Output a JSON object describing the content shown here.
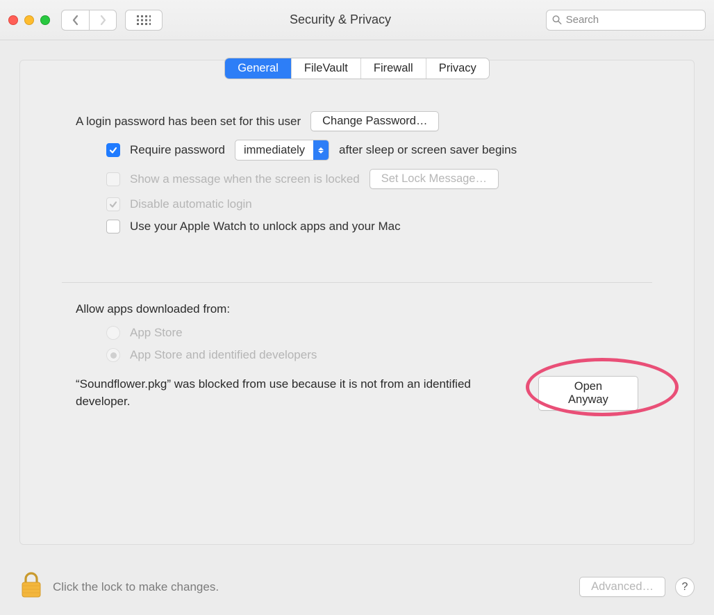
{
  "toolbar": {
    "title": "Security & Privacy",
    "search_placeholder": "Search"
  },
  "tabs": {
    "items": [
      {
        "label": "General",
        "active": true
      },
      {
        "label": "FileVault",
        "active": false
      },
      {
        "label": "Firewall",
        "active": false
      },
      {
        "label": "Privacy",
        "active": false
      }
    ]
  },
  "general": {
    "login_set_text": "A login password has been set for this user",
    "change_password_label": "Change Password…",
    "require_password_label": "Require password",
    "require_password_value": "immediately",
    "require_password_after": "after sleep or screen saver begins",
    "show_message_label": "Show a message when the screen is locked",
    "set_lock_message_label": "Set Lock Message…",
    "disable_auto_login_label": "Disable automatic login",
    "apple_watch_label": "Use your Apple Watch to unlock apps and your Mac"
  },
  "allow": {
    "heading": "Allow apps downloaded from:",
    "option_appstore": "App Store",
    "option_identified": "App Store and identified developers",
    "blocked_text": "“Soundflower.pkg” was blocked from use because it is not from an identified developer.",
    "open_anyway_label": "Open Anyway"
  },
  "footer": {
    "lock_text": "Click the lock to make changes.",
    "advanced_label": "Advanced…",
    "help_label": "?"
  }
}
